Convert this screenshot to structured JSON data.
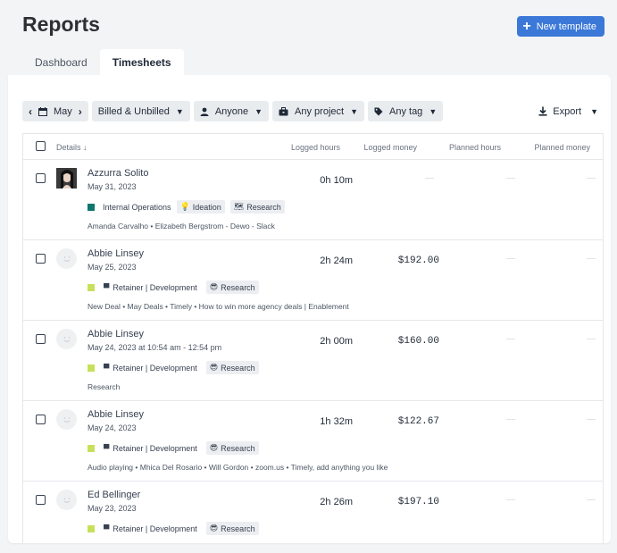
{
  "page": {
    "title": "Reports",
    "new_template": "New template"
  },
  "tabs": [
    {
      "label": "Dashboard"
    },
    {
      "label": "Timesheets"
    }
  ],
  "toolbar": {
    "period": "May",
    "billing": "Billed & Unbilled",
    "person": "Anyone",
    "project": "Any project",
    "tag": "Any tag",
    "export": "Export"
  },
  "table": {
    "headers": {
      "details": "Details",
      "logged_hours": "Logged hours",
      "logged_money": "Logged money",
      "planned_hours": "Planned hours",
      "planned_money": "Planned money"
    },
    "empty": "—",
    "rows": [
      {
        "name": "Azzurra Solito",
        "date": "May 31, 2023",
        "project": "Internal Operations",
        "project_color": "#0f766e",
        "tags": [
          {
            "icon": "💡",
            "label": "Ideation"
          },
          {
            "icon": "🗺",
            "label": "Research"
          }
        ],
        "description": "Amanda Carvalho • Elizabeth Bergstrom - Dewo - Slack",
        "hours": "0h 10m",
        "money": "—"
      },
      {
        "name": "Abbie Linsey",
        "date": "May 25, 2023",
        "project": "Retainer | Development",
        "project_color": "#c6e05a",
        "tags": [
          {
            "icon": "😎",
            "label": "Research"
          }
        ],
        "description": "New Deal • May Deals • Timely • How to win more agency deals | Enablement",
        "hours": "2h 24m",
        "money": "$192.00"
      },
      {
        "name": "Abbie Linsey",
        "date": "May 24, 2023 at 10:54 am - 12:54 pm",
        "project": "Retainer | Development",
        "project_color": "#c6e05a",
        "tags": [
          {
            "icon": "😎",
            "label": "Research"
          }
        ],
        "description": "Research",
        "hours": "2h 00m",
        "money": "$160.00"
      },
      {
        "name": "Abbie Linsey",
        "date": "May 24, 2023",
        "project": "Retainer | Development",
        "project_color": "#c6e05a",
        "tags": [
          {
            "icon": "😎",
            "label": "Research"
          }
        ],
        "description": "Audio playing • Mhica Del Rosario • Will Gordon • zoom.us • Timely, add anything you like",
        "hours": "1h 32m",
        "money": "$122.67"
      },
      {
        "name": "Ed Bellinger",
        "date": "May 23, 2023",
        "project": "Retainer | Development",
        "project_color": "#c6e05a",
        "tags": [
          {
            "icon": "😎",
            "label": "Research"
          }
        ],
        "description": "",
        "hours": "2h 26m",
        "money": "$197.10"
      }
    ]
  }
}
